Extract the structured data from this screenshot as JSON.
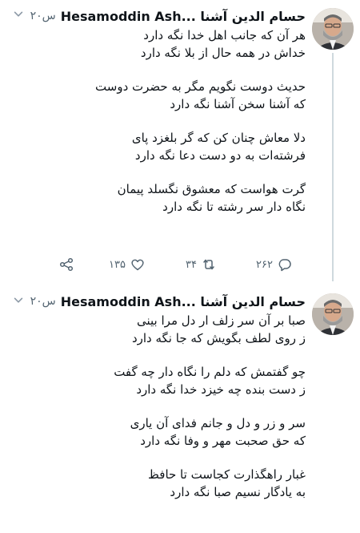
{
  "tweets": [
    {
      "author": "Hesamoddin Ash... حسام الدین آشنا",
      "time": "۲۰س",
      "stanzas": [
        [
          "هر آن که جانب اهل خدا نگه دارد",
          "خداش در همه حال از بلا نگه دارد"
        ],
        [
          "حدیث دوست نگویم مگر به حضرت دوست",
          "که آشنا سخن آشنا نگه دارد"
        ],
        [
          "دلا معاش چنان کن که گر بلغزد پای",
          "فرشته‌ات به دو دست دعا نگه دارد"
        ],
        [
          "گرت هواست که معشوق نگسلد پیمان",
          "نگاه دار سر رشته تا نگه دارد"
        ]
      ],
      "actions": {
        "replies": "۲۶۲",
        "retweets": "۳۴",
        "likes": "۱۳۵"
      }
    },
    {
      "author": "Hesamoddin Ash... حسام الدین آشنا",
      "time": "۲۰س",
      "stanzas": [
        [
          "صبا بر آن سر زلف ار دل مرا بینی",
          "ز روی لطف بگویش که جا نگه دارد"
        ],
        [
          "چو گفتمش که دلم را نگاه دار چه گفت",
          "ز دست بنده چه خیزد خدا نگه دارد"
        ],
        [
          "سر و زر و دل و جانم فدای آن یاری",
          "که حق صحبت مهر و وفا نگه دارد"
        ],
        [
          "غبار راهگذارت کجاست تا حافظ",
          "به یادگار نسیم صبا نگه دارد"
        ]
      ]
    }
  ],
  "colors": {
    "text": "#0f1419",
    "muted": "#536471",
    "thread": "#cfd9de"
  },
  "icons": {
    "more": "chevron-down-icon",
    "reply": "reply-icon",
    "retweet": "retweet-icon",
    "like": "heart-icon",
    "share": "share-icon"
  }
}
